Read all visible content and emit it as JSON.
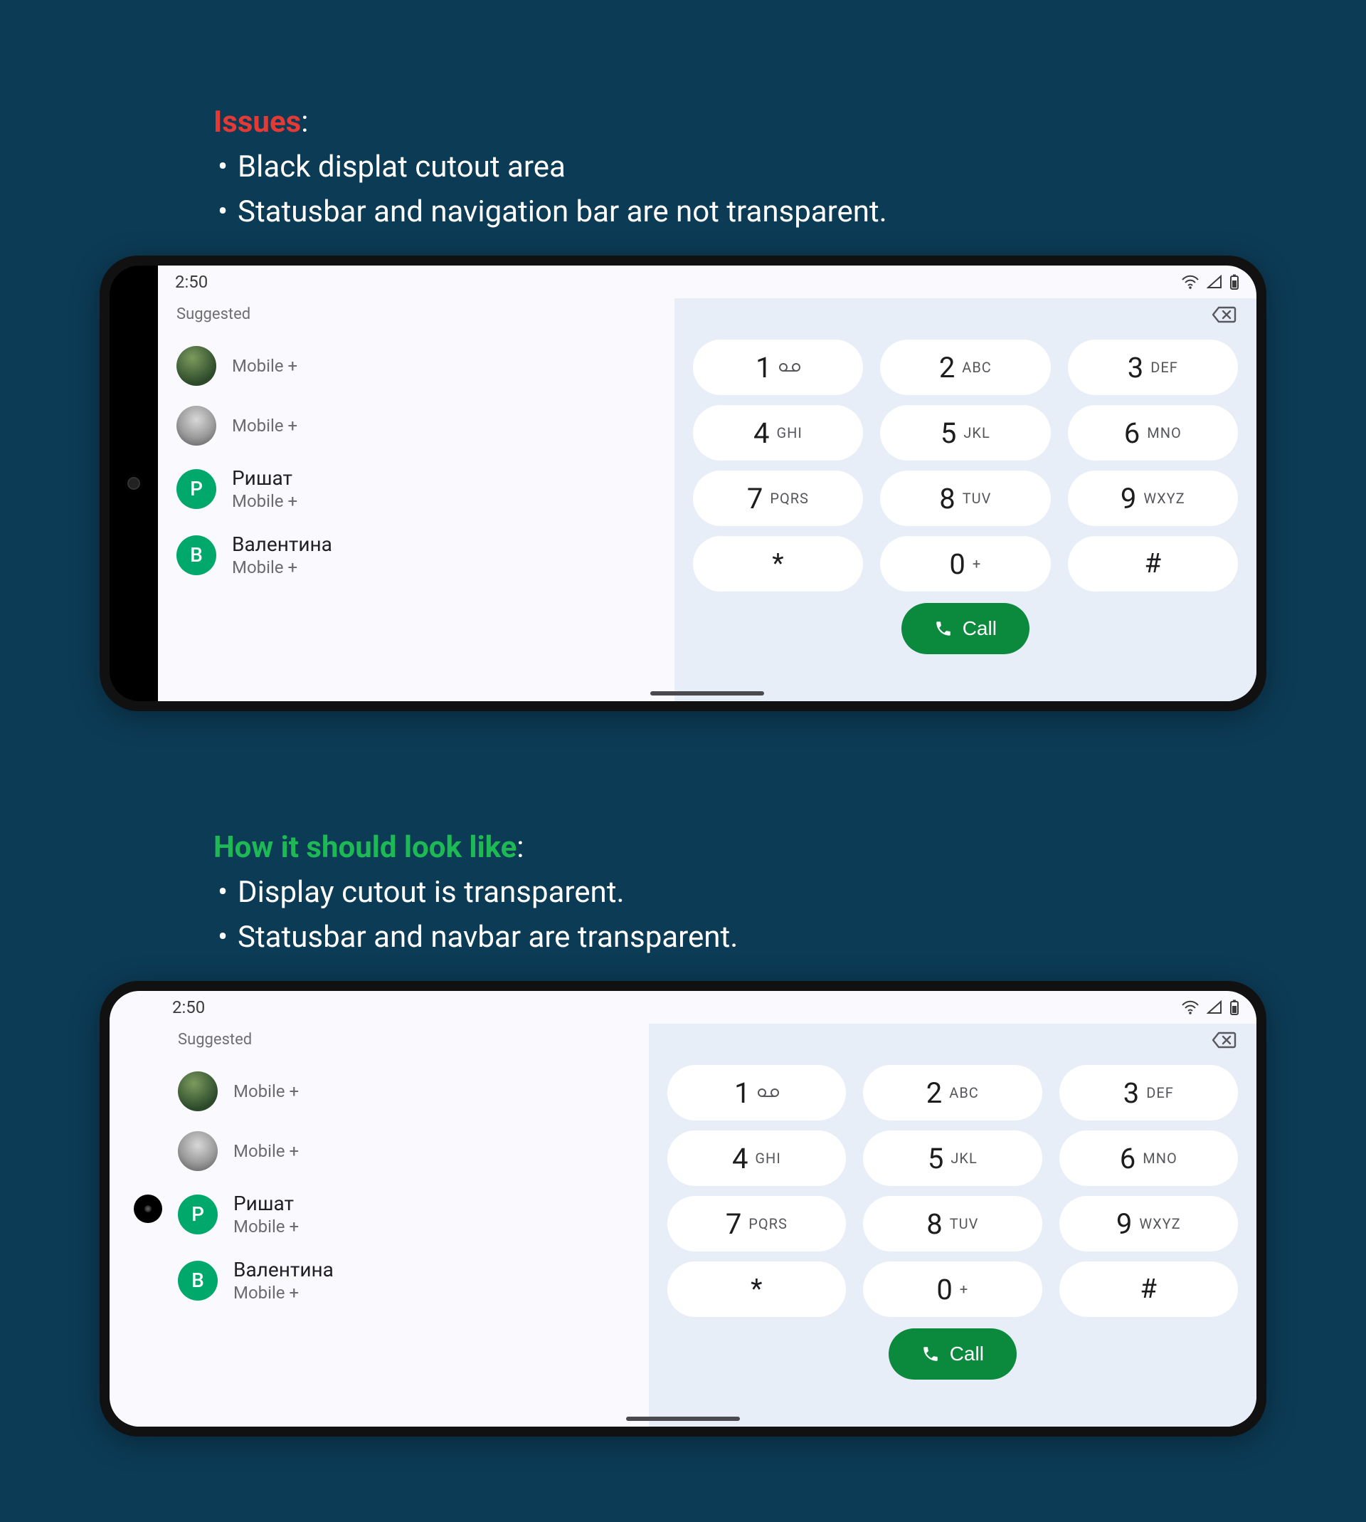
{
  "sections": {
    "issues": {
      "title": "Issues",
      "bullets": [
        "Black displat cutout area",
        "Statusbar and navigation bar are not transparent."
      ]
    },
    "expected": {
      "title": "How it should look like",
      "bullets": [
        "Display cutout is transparent.",
        "Statusbar and navbar are transparent."
      ]
    }
  },
  "statusbar": {
    "time": "2:50"
  },
  "contacts": {
    "suggested_label": "Suggested",
    "items": [
      {
        "name": "",
        "sub": "Mobile +",
        "avatar": "img1",
        "initial": ""
      },
      {
        "name": "",
        "sub": "Mobile +",
        "avatar": "img2",
        "initial": ""
      },
      {
        "name": "Ришат",
        "sub": "Mobile +",
        "avatar": "letter",
        "initial": "Р"
      },
      {
        "name": "Валентина",
        "sub": "Mobile +",
        "avatar": "letter",
        "initial": "В"
      }
    ]
  },
  "dialer": {
    "keys": [
      {
        "num": "1",
        "sub": ""
      },
      {
        "num": "2",
        "sub": "ABC"
      },
      {
        "num": "3",
        "sub": "DEF"
      },
      {
        "num": "4",
        "sub": "GHI"
      },
      {
        "num": "5",
        "sub": "JKL"
      },
      {
        "num": "6",
        "sub": "MNO"
      },
      {
        "num": "7",
        "sub": "PQRS"
      },
      {
        "num": "8",
        "sub": "TUV"
      },
      {
        "num": "9",
        "sub": "WXYZ"
      },
      {
        "num": "*",
        "sub": ""
      },
      {
        "num": "0",
        "sub": "+"
      },
      {
        "num": "#",
        "sub": ""
      }
    ],
    "call_label": "Call"
  }
}
